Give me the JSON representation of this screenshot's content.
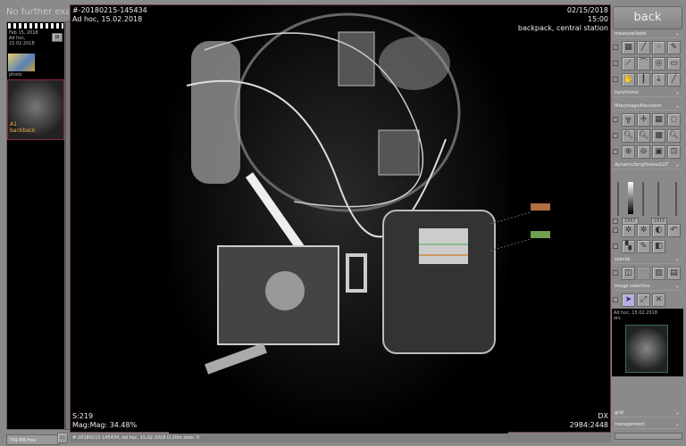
{
  "left_panel": {
    "header": "No further exam",
    "exam": {
      "date": "Feb 15, 2018",
      "type": "Ad hoc,",
      "date2": "15.02.2018"
    },
    "thumbnails": [
      {
        "label": "photo"
      },
      {
        "label": "A1 backback",
        "selected": true
      }
    ],
    "free_space": "749 MB free"
  },
  "viewer": {
    "top_left": [
      "#-20180215-145434",
      "Ad hoc, 15.02.2018"
    ],
    "top_right": [
      "02/15/2018",
      "15:00",
      "backpack, central station"
    ],
    "bottom_left": [
      "S:219",
      "Mag:Mag: 34.48%"
    ],
    "bottom_right": [
      "DX",
      "2984:2448"
    ],
    "annotations": [
      {
        "color": "#b07040"
      },
      {
        "color": "#70a050"
      }
    ]
  },
  "status_bar": "#-20180215-145434, Ad hoc, 15.02.2018 D:20m date: 0",
  "right_panel": {
    "back": "back",
    "sections": {
      "measure": "measure/label",
      "turn": "turn/mirror",
      "filter": "filter/magnifier/zoom",
      "dynamic": "dynamic/brightness/LUT",
      "special": "special",
      "selection": "image selection",
      "grid": "grid",
      "management": "management"
    },
    "window_values": [
      "1957",
      "1915"
    ],
    "preview": {
      "title": "Ad hoc, 15.02.2018",
      "sub": "ors"
    }
  },
  "colors": {
    "selection_border": "#8a2b3c",
    "background": "#8a8a8a"
  }
}
